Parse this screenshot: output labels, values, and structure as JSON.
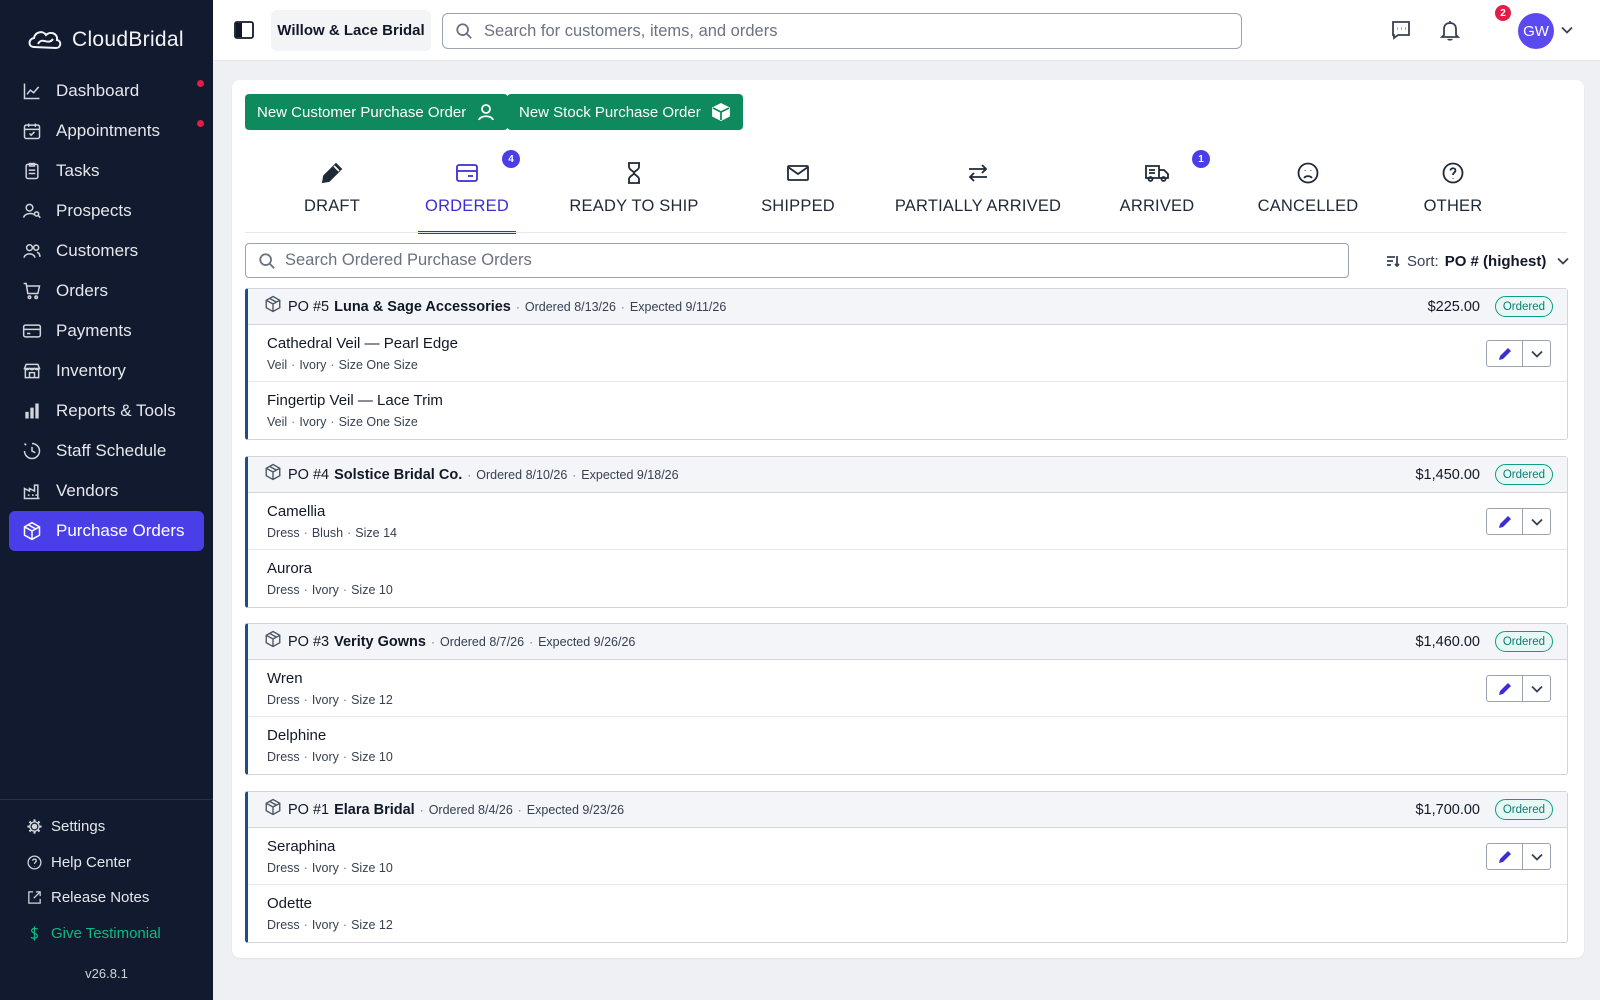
{
  "brand": {
    "name": "CloudBridal"
  },
  "sidebar": {
    "items": [
      {
        "label": "Dashboard",
        "icon": "chart-line-icon",
        "dot": true
      },
      {
        "label": "Appointments",
        "icon": "calendar-icon",
        "dot": true
      },
      {
        "label": "Tasks",
        "icon": "clipboard-icon",
        "dot": false
      },
      {
        "label": "Prospects",
        "icon": "user-search-icon",
        "dot": false
      },
      {
        "label": "Customers",
        "icon": "users-icon",
        "dot": false
      },
      {
        "label": "Orders",
        "icon": "cart-icon",
        "dot": false
      },
      {
        "label": "Payments",
        "icon": "card-icon",
        "dot": false
      },
      {
        "label": "Inventory",
        "icon": "store-icon",
        "dot": false
      },
      {
        "label": "Reports & Tools",
        "icon": "bar-chart-icon",
        "dot": false
      },
      {
        "label": "Staff Schedule",
        "icon": "clock-icon",
        "dot": false
      },
      {
        "label": "Vendors",
        "icon": "factory-icon",
        "dot": false
      },
      {
        "label": "Purchase Orders",
        "icon": "box-icon",
        "dot": false,
        "active": true
      }
    ],
    "bottom": [
      {
        "label": "Settings",
        "icon": "gear-icon"
      },
      {
        "label": "Help Center",
        "icon": "help-icon"
      },
      {
        "label": "Release Notes",
        "icon": "external-link-icon"
      },
      {
        "label": "Give Testimonial",
        "icon": "dollar-icon"
      }
    ],
    "version": "v26.8.1"
  },
  "topbar": {
    "store": "Willow & Lace Bridal",
    "search_placeholder": "Search for customers, items, and orders",
    "notification_count": "2",
    "avatar_initials": "GW"
  },
  "actions": {
    "new_customer_po": "New Customer Purchase Order",
    "new_stock_po": "New Stock Purchase Order"
  },
  "tabs": [
    {
      "label": "DRAFT",
      "icon": "pencil-icon",
      "badge": null
    },
    {
      "label": "ORDERED",
      "icon": "ordered-icon",
      "badge": "4",
      "active": true
    },
    {
      "label": "READY TO SHIP",
      "icon": "hourglass-icon",
      "badge": null
    },
    {
      "label": "SHIPPED",
      "icon": "mail-icon",
      "badge": null
    },
    {
      "label": "PARTIALLY ARRIVED",
      "icon": "arrows-swap-icon",
      "badge": null
    },
    {
      "label": "ARRIVED",
      "icon": "truck-icon",
      "badge": "1"
    },
    {
      "label": "CANCELLED",
      "icon": "frown-icon",
      "badge": null
    },
    {
      "label": "OTHER",
      "icon": "question-icon",
      "badge": null
    }
  ],
  "list": {
    "search_placeholder": "Search Ordered Purchase Orders",
    "sort_label": "Sort:",
    "sort_value": "PO # (highest)"
  },
  "purchase_orders": [
    {
      "number": "PO #5",
      "vendor": "Luna & Sage Accessories",
      "ordered": "Ordered 8/13/26",
      "expected": "Expected 9/11/26",
      "total": "$225.00",
      "status": "Ordered",
      "items": [
        {
          "name": "Cathedral Veil — Pearl Edge",
          "type": "Veil",
          "color": "Ivory",
          "size": "Size One Size"
        },
        {
          "name": "Fingertip Veil — Lace Trim",
          "type": "Veil",
          "color": "Ivory",
          "size": "Size One Size"
        }
      ]
    },
    {
      "number": "PO #4",
      "vendor": "Solstice Bridal Co.",
      "ordered": "Ordered 8/10/26",
      "expected": "Expected 9/18/26",
      "total": "$1,450.00",
      "status": "Ordered",
      "items": [
        {
          "name": "Camellia",
          "type": "Dress",
          "color": "Blush",
          "size": "Size 14"
        },
        {
          "name": "Aurora",
          "type": "Dress",
          "color": "Ivory",
          "size": "Size 10"
        }
      ]
    },
    {
      "number": "PO #3",
      "vendor": "Verity Gowns",
      "ordered": "Ordered 8/7/26",
      "expected": "Expected 9/26/26",
      "total": "$1,460.00",
      "status": "Ordered",
      "items": [
        {
          "name": "Wren",
          "type": "Dress",
          "color": "Ivory",
          "size": "Size 12"
        },
        {
          "name": "Delphine",
          "type": "Dress",
          "color": "Ivory",
          "size": "Size 10"
        }
      ]
    },
    {
      "number": "PO #1",
      "vendor": "Elara Bridal",
      "ordered": "Ordered 8/4/26",
      "expected": "Expected 9/23/26",
      "total": "$1,700.00",
      "status": "Ordered",
      "items": [
        {
          "name": "Seraphina",
          "type": "Dress",
          "color": "Ivory",
          "size": "Size 10"
        },
        {
          "name": "Odette",
          "type": "Dress",
          "color": "Ivory",
          "size": "Size 12"
        }
      ]
    }
  ]
}
